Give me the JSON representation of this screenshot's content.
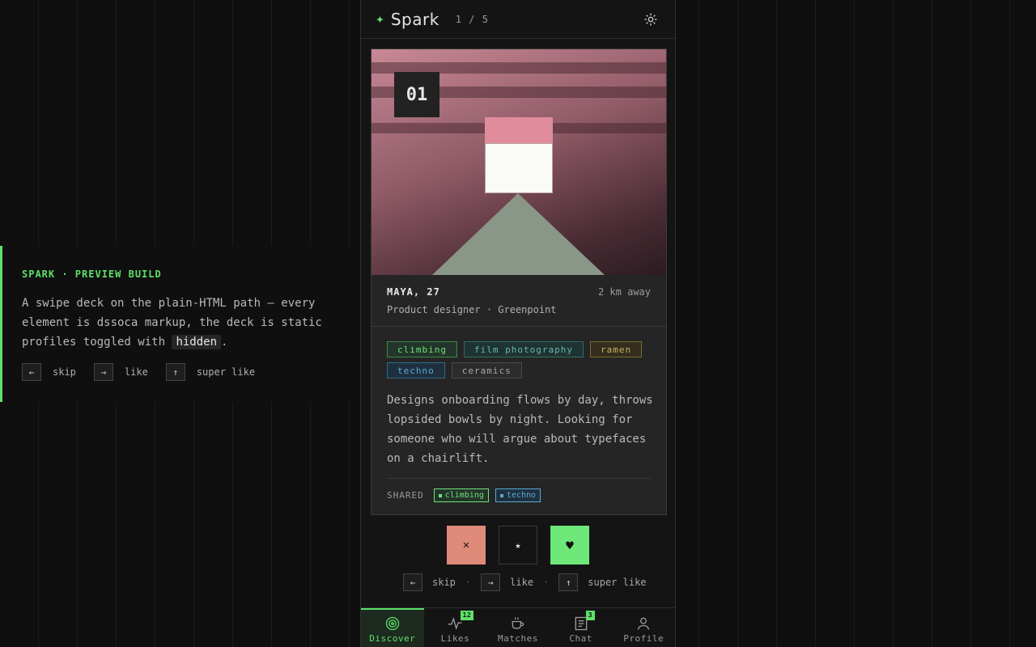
{
  "info": {
    "title": "SPARK · PREVIEW BUILD",
    "text_before": "A swipe deck on the plain-HTML path — every element is dssoca markup, the deck is static profiles toggled with ",
    "code": "hidden",
    "text_after": ".",
    "keys": [
      {
        "key": "←",
        "label": "skip"
      },
      {
        "key": "→",
        "label": "like"
      },
      {
        "key": "↑",
        "label": "super like"
      }
    ]
  },
  "app": {
    "name": "Spark",
    "counter": "1 / 5",
    "settings_icon": "gear-icon"
  },
  "profile": {
    "number": "01",
    "name": "MAYA, 27",
    "distance": "2 km away",
    "job": "Product designer · Greenpoint",
    "tags": [
      "climbing",
      "film photography",
      "ramen",
      "techno",
      "ceramics"
    ],
    "bio": "Designs onboarding flows by day, throws lopsided bowls by night. Looking for someone who will argue about typefaces on a chairlift.",
    "shared_label": "SHARED",
    "shared": [
      "climbing",
      "techno"
    ]
  },
  "actions": {
    "skip": "✕",
    "super_like": "★",
    "like": "♥"
  },
  "hints": [
    {
      "key": "←",
      "label": "skip"
    },
    {
      "key": "→",
      "label": "like"
    },
    {
      "key": "↑",
      "label": "super like"
    }
  ],
  "nav": [
    {
      "label": "Discover",
      "badge": ""
    },
    {
      "label": "Likes",
      "badge": "12"
    },
    {
      "label": "Matches",
      "badge": ""
    },
    {
      "label": "Chat",
      "badge": "3"
    },
    {
      "label": "Profile",
      "badge": ""
    }
  ],
  "colors": {
    "accent": "#5ee06a",
    "skip": "#e08a7a",
    "background": "#0f0f0f"
  }
}
